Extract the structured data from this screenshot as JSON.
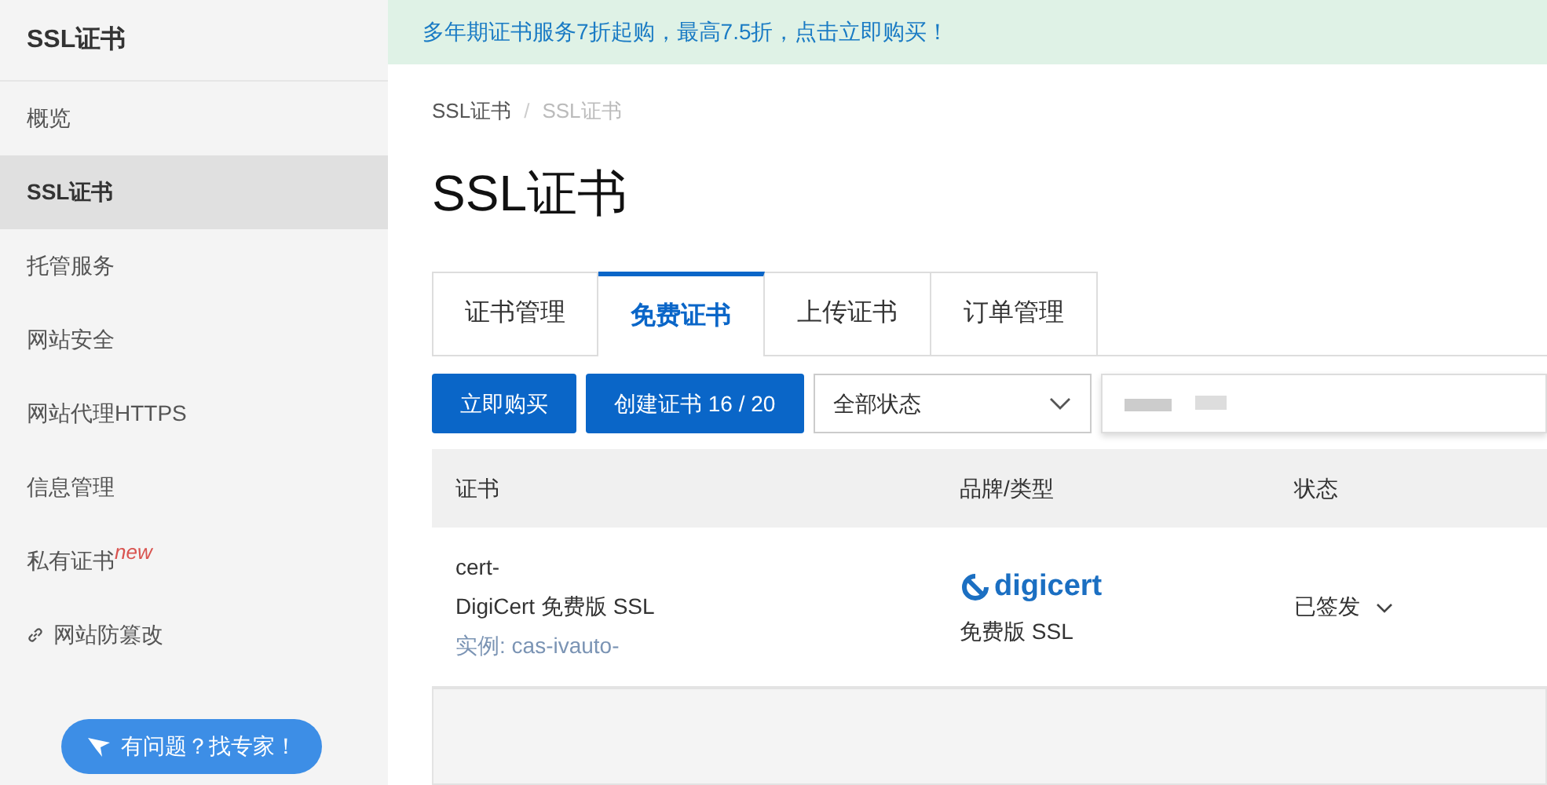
{
  "sidebar": {
    "title": "SSL证书",
    "items": [
      {
        "label": "概览",
        "selected": false
      },
      {
        "label": "SSL证书",
        "selected": true
      },
      {
        "label": "托管服务",
        "selected": false
      },
      {
        "label": "网站安全",
        "selected": false
      },
      {
        "label": "网站代理HTTPS",
        "selected": false
      },
      {
        "label": "信息管理",
        "selected": false
      },
      {
        "label": "私有证书",
        "selected": false,
        "badge": "new"
      },
      {
        "label": "网站防篡改",
        "selected": false,
        "kind": "link"
      }
    ],
    "help_button": "有问题？找专家！"
  },
  "banner": "多年期证书服务7折起购，最高7.5折，点击立即购买！",
  "breadcrumb": [
    "SSL证书",
    "SSL证书"
  ],
  "breadcrumb_separator": "/",
  "page_title": "SSL证书",
  "tabs": [
    {
      "label": "证书管理",
      "selected": false
    },
    {
      "label": "免费证书",
      "selected": true
    },
    {
      "label": "上传证书",
      "selected": false
    },
    {
      "label": "订单管理",
      "selected": false
    }
  ],
  "toolbar": {
    "buy_button": "立即购买",
    "create_button": "创建证书 16 / 20",
    "status_select": "全部状态"
  },
  "table": {
    "columns": [
      "证书",
      "品牌/类型",
      "状态"
    ],
    "rows": [
      {
        "cert_id": "cert-",
        "cert_name": "DigiCert 免费版 SSL",
        "instance": "实例: cas-ivauto-",
        "brand_logo": "digicert",
        "type": "免费版 SSL",
        "status": "已签发"
      }
    ]
  }
}
